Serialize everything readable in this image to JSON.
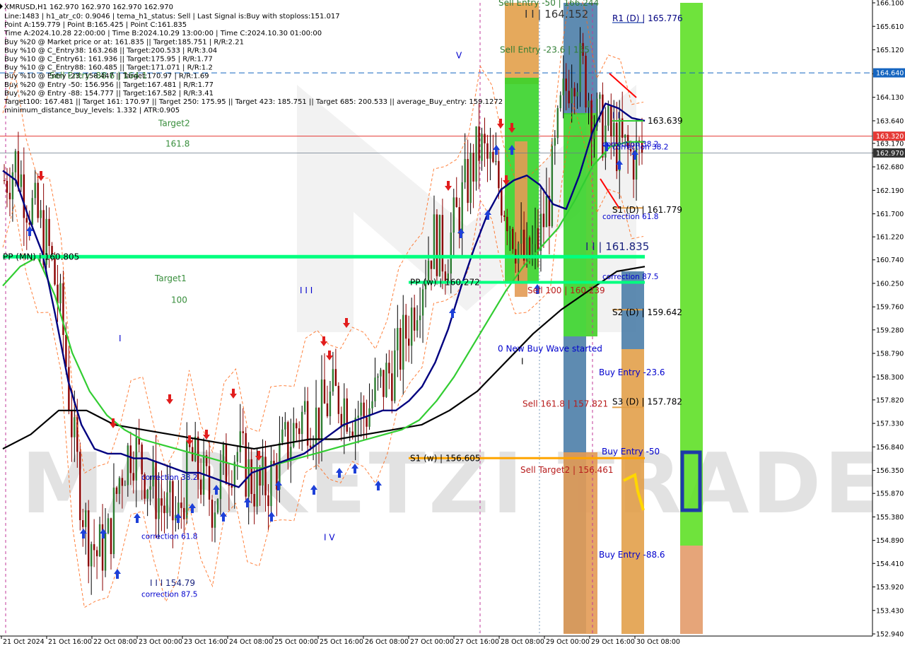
{
  "symbol_header": "XMRUSD,H1  162.970 162.970 162.970 162.970",
  "info_lines": [
    "Line:1483 | h1_atr_c0: 0.9046 | tema_h1_status: Sell | Last Signal is:Buy with stoploss:151.017",
    "Point A:159.779 | Point B:165.425 | Point C:161.835",
    "Time A:2024.10.28 22:00:00 | Time B:2024.10.29 13:00:00 | Time C:2024.10.30 01:00:00",
    "Buy %20 @ Market price or at: 161.835 || Target:185.751 | R/R:2.21",
    "Buy %10 @ C_Entry38: 163.268 || Target:200.533 | R/R:3.04",
    "Buy %10 @ C_Entry61: 161.936 || Target:175.95 | R/R:1.77",
    "Buy %10 @ C_Entry88: 160.485 || Target:171.071 | R/R:1.2",
    "Buy %10 @ Entry -23: 158.447 || Target:170.97 | R/R:1.69",
    "Buy %20 @ Entry -50: 156.956 || Target:167.481 | R/R:1.77",
    "Buy %20 @ Entry -88: 154.777 || Target:167.582 | R/R:3.41",
    "Target100: 167.481 || Target 161: 170.97 || Target 250: 175.95 || Target 423: 185.751 || Target 685: 200.533 || average_Buy_entry: 159.1272",
    "minimum_distance_buy_levels: 1.332 | ATR:0.905"
  ],
  "price_axis": {
    "min": 152.94,
    "max": 166.1,
    "ticks": [
      "166.100",
      "165.610",
      "165.120",
      "164.620",
      "164.130",
      "163.640",
      "163.170",
      "162.970",
      "162.680",
      "162.190",
      "161.700",
      "161.220",
      "160.740",
      "160.250",
      "159.760",
      "159.280",
      "158.790",
      "158.300",
      "157.820",
      "157.330",
      "156.840",
      "156.350",
      "155.870",
      "155.380",
      "154.890",
      "154.410",
      "153.920",
      "153.430",
      "152.940"
    ],
    "tick_values": [
      166.1,
      165.61,
      165.12,
      164.62,
      164.13,
      163.64,
      163.17,
      162.97,
      162.68,
      162.19,
      161.7,
      161.22,
      160.74,
      160.25,
      159.76,
      159.28,
      158.79,
      158.3,
      157.82,
      157.33,
      156.84,
      156.35,
      155.87,
      155.38,
      154.89,
      154.41,
      153.92,
      153.43,
      152.94
    ],
    "price_tags": [
      {
        "label": "164.640",
        "value": 164.64,
        "color": "#1565c0"
      },
      {
        "label": "163.320",
        "value": 163.32,
        "color": "#e53935"
      },
      {
        "label": "162.970",
        "value": 162.97,
        "color": "#333333"
      }
    ]
  },
  "time_axis": {
    "labels": [
      "21 Oct 2024",
      "21 Oct 16:00",
      "22 Oct 08:00",
      "23 Oct 00:00",
      "23 Oct 16:00",
      "24 Oct 08:00",
      "25 Oct 00:00",
      "25 Oct 16:00",
      "26 Oct 08:00",
      "27 Oct 00:00",
      "27 Oct 16:00",
      "28 Oct 08:00",
      "29 Oct 00:00",
      "29 Oct 16:00",
      "30 Oct 08:00"
    ]
  },
  "watermark": "MARKETZI TRADE",
  "annotations": [
    {
      "text": "R1 (D) | 165.776",
      "price": 165.776,
      "color": "#000080"
    },
    {
      "text": "163.639",
      "price": 163.639,
      "color": "#000000"
    },
    {
      "text": "S1 (D) | 161.779",
      "price": 161.779,
      "color": "#000000"
    },
    {
      "text": "S2 (D) | 159.642",
      "price": 159.642,
      "color": "#000000"
    },
    {
      "text": "S3 (D) | 157.782",
      "price": 157.782,
      "color": "#000000"
    },
    {
      "text": "PP (MN) | 160.805",
      "price": 160.805,
      "color": "#000000"
    },
    {
      "text": "PP (w) | 160.272",
      "price": 160.272,
      "color": "#000000"
    },
    {
      "text": "S1 (w) | 156.605",
      "price": 156.605,
      "color": "#000000"
    },
    {
      "text": "Sell Entry -23.6 | 165",
      "price": 165.12,
      "color": "#2e7d32"
    },
    {
      "text": "Sell Entry -50 | 166.244",
      "price": 166.1,
      "color": "#2e7d32"
    },
    {
      "text": "I I | 164.152",
      "price": 165.85,
      "color": "#333333"
    },
    {
      "text": "I I | 161.835",
      "price": 161.0,
      "color": "#1a237e"
    },
    {
      "text": "I I I 154.79",
      "price": 154.0,
      "color": "#1a237e"
    },
    {
      "text": "Sell 100 | 160.239",
      "price": 160.1,
      "color": "#b71c1c"
    },
    {
      "text": "Sell 161.8 | 157.821",
      "price": 157.74,
      "color": "#b71c1c"
    },
    {
      "text": "Sell Target2 | 156.461",
      "price": 156.361,
      "color": "#b71c1c"
    },
    {
      "text": "0 New Buy Wave started",
      "price": 158.89,
      "color": "#0000cd"
    },
    {
      "text": "Buy Entry -23.6",
      "price": 158.39,
      "color": "#0000cd"
    },
    {
      "text": "Buy Entry -50",
      "price": 156.74,
      "color": "#0000cd"
    },
    {
      "text": "Buy Entry -88.6",
      "price": 154.59,
      "color": "#0000cd"
    },
    {
      "text": "correction 38.2",
      "price": 163.16,
      "color": "#0000cd"
    },
    {
      "text": "correction 61.8",
      "price": 161.65,
      "color": "#0000cd"
    },
    {
      "text": "correction 87.5",
      "price": 160.4,
      "color": "#0000cd"
    },
    {
      "text": "correction 38.2",
      "price": 156.21,
      "color": "#0000cd"
    },
    {
      "text": "correction 61.8",
      "price": 154.98,
      "color": "#0000cd"
    },
    {
      "text": "correction 87.5",
      "price": 153.77,
      "color": "#0000cd"
    },
    {
      "text": "Target2",
      "price": 163.59,
      "color": "#388e3c"
    },
    {
      "text": "161.8",
      "price": 163.16,
      "color": "#388e3c"
    },
    {
      "text": "Target1",
      "price": 160.35,
      "color": "#388e3c"
    },
    {
      "text": "100",
      "price": 159.9,
      "color": "#388e3c"
    },
    {
      "text": "V",
      "price": 165.0,
      "color": "#0000cd"
    },
    {
      "text": "I",
      "price": 159.1,
      "color": "#0000cd"
    },
    {
      "text": "I I I",
      "price": 160.1,
      "color": "#0000cd"
    },
    {
      "text": "I V",
      "price": 154.95,
      "color": "#0000cd"
    },
    {
      "text": "I",
      "price": 158.62,
      "color": "#000000"
    },
    {
      "text": "Sell Entry -88.6 | 164.1",
      "price": 164.58,
      "color": "#2e7d32"
    },
    {
      "text": "correction 38.2",
      "price": 163.1,
      "color": "#0000cd"
    },
    {
      "text": "I I",
      "price": 163.75,
      "color": "#000080"
    }
  ],
  "colors": {
    "bull_candle": "#000000",
    "bear_candle": "#8b0000",
    "ema_fast": "#000080",
    "ema_mid": "#32cd32",
    "ema_slow": "#000000",
    "pp_line": "#00ff7f",
    "orange_line": "#ffa500",
    "grid_hline_blue": "#1565c0",
    "grid_hline_red": "#e53935"
  },
  "chart_data": {
    "type": "candlestick",
    "symbol": "XMRUSD",
    "timeframe": "H1",
    "last_price": 162.97,
    "ylim": [
      152.94,
      166.1
    ],
    "xlabels": [
      "21 Oct 2024",
      "21 Oct 16:00",
      "22 Oct 08:00",
      "23 Oct 00:00",
      "23 Oct 16:00",
      "24 Oct 08:00",
      "25 Oct 00:00",
      "25 Oct 16:00",
      "26 Oct 08:00",
      "27 Oct 00:00",
      "27 Oct 16:00",
      "28 Oct 08:00",
      "29 Oct 00:00",
      "29 Oct 16:00",
      "30 Oct 08:00"
    ],
    "close_path_approx": [
      162.4,
      162.8,
      162.0,
      161.5,
      160.8,
      159.4,
      156.9,
      155.2,
      154.6,
      154.9,
      156.3,
      156.9,
      156.4,
      155.9,
      155.5,
      155.3,
      156.6,
      156.2,
      155.7,
      156.4,
      156.8,
      156.3,
      155.9,
      156.2,
      156.7,
      157.2,
      157.6,
      157.4,
      157.8,
      157.9,
      157.6,
      157.5,
      157.9,
      158.3,
      158.7,
      159.5,
      160.4,
      161.2,
      160.8,
      161.6,
      162.4,
      163.1,
      162.6,
      162.1,
      161.3,
      160.6,
      161.1,
      162.0,
      163.8,
      164.9,
      164.6,
      163.6,
      163.4,
      163.1,
      162.9,
      162.97
    ],
    "ema_fast_path": [
      162.6,
      162.4,
      161.6,
      160.9,
      159.6,
      158.2,
      157.3,
      156.8,
      156.7,
      156.7,
      156.6,
      156.6,
      156.5,
      156.4,
      156.3,
      156.3,
      156.2,
      156.1,
      156.0,
      156.3,
      156.4,
      156.5,
      156.6,
      156.7,
      156.9,
      157.1,
      157.3,
      157.4,
      157.5,
      157.6,
      157.6,
      157.8,
      158.1,
      158.6,
      159.3,
      160.2,
      161.0,
      161.7,
      162.2,
      162.4,
      162.5,
      162.3,
      161.9,
      161.8,
      162.5,
      163.4,
      164.0,
      163.9,
      163.7,
      163.64
    ],
    "ema_mid_path": [
      160.2,
      160.6,
      160.8,
      160.0,
      158.8,
      158.0,
      157.5,
      157.2,
      157.0,
      156.9,
      156.8,
      156.7,
      156.6,
      156.5,
      156.4,
      156.4,
      156.5,
      156.6,
      156.7,
      156.8,
      156.9,
      157.0,
      157.1,
      157.2,
      157.4,
      157.8,
      158.3,
      158.9,
      159.5,
      160.1,
      160.6,
      161.0,
      161.4,
      162.0,
      162.7,
      163.1,
      163.2,
      163.2
    ],
    "ema_slow_path": [
      156.8,
      157.1,
      157.6,
      157.6,
      157.3,
      157.2,
      157.1,
      157.0,
      156.9,
      156.8,
      156.9,
      157.0,
      157.0,
      157.1,
      157.2,
      157.3,
      157.6,
      158.0,
      158.6,
      159.2,
      159.7,
      160.1,
      160.5,
      160.6
    ],
    "levels": {
      "R1_D": 165.776,
      "PP_D": 163.639,
      "S1_D": 161.779,
      "S2_D": 159.642,
      "S3_D": 157.782,
      "PP_MN": 160.805,
      "PP_W": 160.272,
      "S1_W": 156.605,
      "point_A": 159.779,
      "point_B": 165.425,
      "point_C": 161.835
    }
  }
}
